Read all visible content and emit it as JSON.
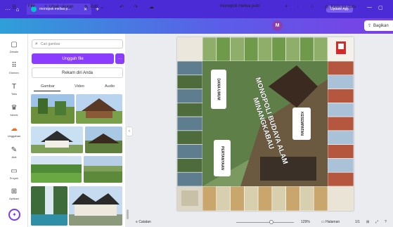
{
  "browser": {
    "tab_title": "monopoli melisa p...",
    "update_label": "Update App",
    "window_controls": [
      "—",
      "▢"
    ]
  },
  "toolbar": {
    "file_label": "File",
    "resize_label": "Ubah ukuran",
    "edit_label": "Edit",
    "doc_title": "monopoli melisa putri",
    "avatar_initial": "M",
    "send_label": "Kirim ke guru",
    "share_label": "Bagikan"
  },
  "rail": {
    "items": [
      {
        "label": "Desain",
        "icon": "▢"
      },
      {
        "label": "Elemen",
        "icon": "⠿"
      },
      {
        "label": "Teks",
        "icon": "T"
      },
      {
        "label": "Merek",
        "icon": "♛"
      },
      {
        "label": "Unggahan",
        "icon": "☁"
      },
      {
        "label": "Alat",
        "icon": "✎"
      },
      {
        "label": "Proyek",
        "icon": "▭"
      },
      {
        "label": "Aplikasi",
        "icon": "⊞"
      }
    ]
  },
  "panel": {
    "search_placeholder": "Cari gambar",
    "upload_label": "Unggah file",
    "more_label": "···",
    "record_label": "Rekam diri Anda",
    "tabs": [
      "Gambar",
      "Video",
      "Audio"
    ]
  },
  "board": {
    "title_line1": "MONOPOLI BUDAYA ALAM",
    "title_line2": "MINANGKABAU",
    "card_dana_umum": "DANA UMUM",
    "card_kesempatan": "KESEMPATAN",
    "card_pertanyaan": "PERTANYAAN"
  },
  "status": {
    "notes_label": "Catatan",
    "zoom": "129%",
    "pages_label": "Halaman",
    "page_count": "1/1"
  },
  "colors": {
    "brand_purple": "#8b3dff",
    "active_icon": "#f26a1b"
  }
}
